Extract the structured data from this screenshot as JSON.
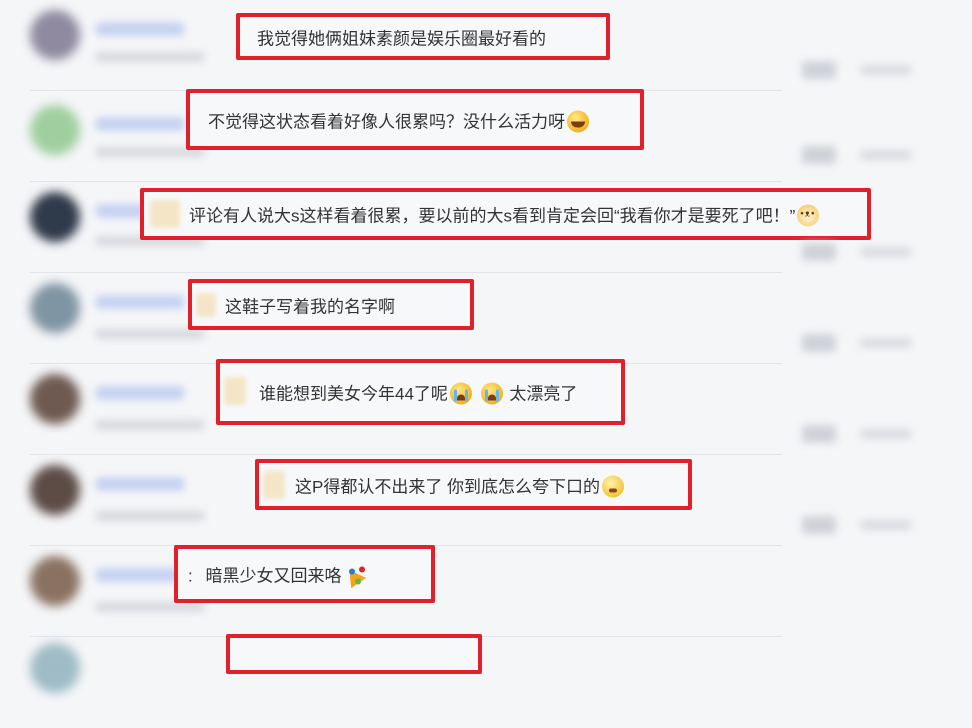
{
  "comments": [
    {
      "text": "我觉得她俩姐妹素颜是娱乐圈最好看的",
      "emoji": null
    },
    {
      "text": "不觉得这状态看着好像人很累吗？没什么活力呀",
      "emoji": "laugh-cry-icon"
    },
    {
      "text": "评论有人说大s这样看着很累，要以前的大s看到肯定会回“我看你才是要死了吧！”",
      "emoji": "dog-face-icon"
    },
    {
      "text": "这鞋子写着我的名字啊",
      "emoji": null
    },
    {
      "text": "谁能想到美女今年44了呢",
      "emoji": "crying-face-icon",
      "emoji2": "crying-face-icon",
      "text_after": "太漂亮了"
    },
    {
      "text": "这P得都认不出来了 你到底怎么夸下口的",
      "emoji": "prayer-face-icon"
    },
    {
      "text": "暗黑少女又回来咯",
      "emoji": "party-popper-icon",
      "prefix": ":"
    }
  ],
  "colors": {
    "highlight_border": "#e0202a",
    "background": "#f5f6f8"
  }
}
